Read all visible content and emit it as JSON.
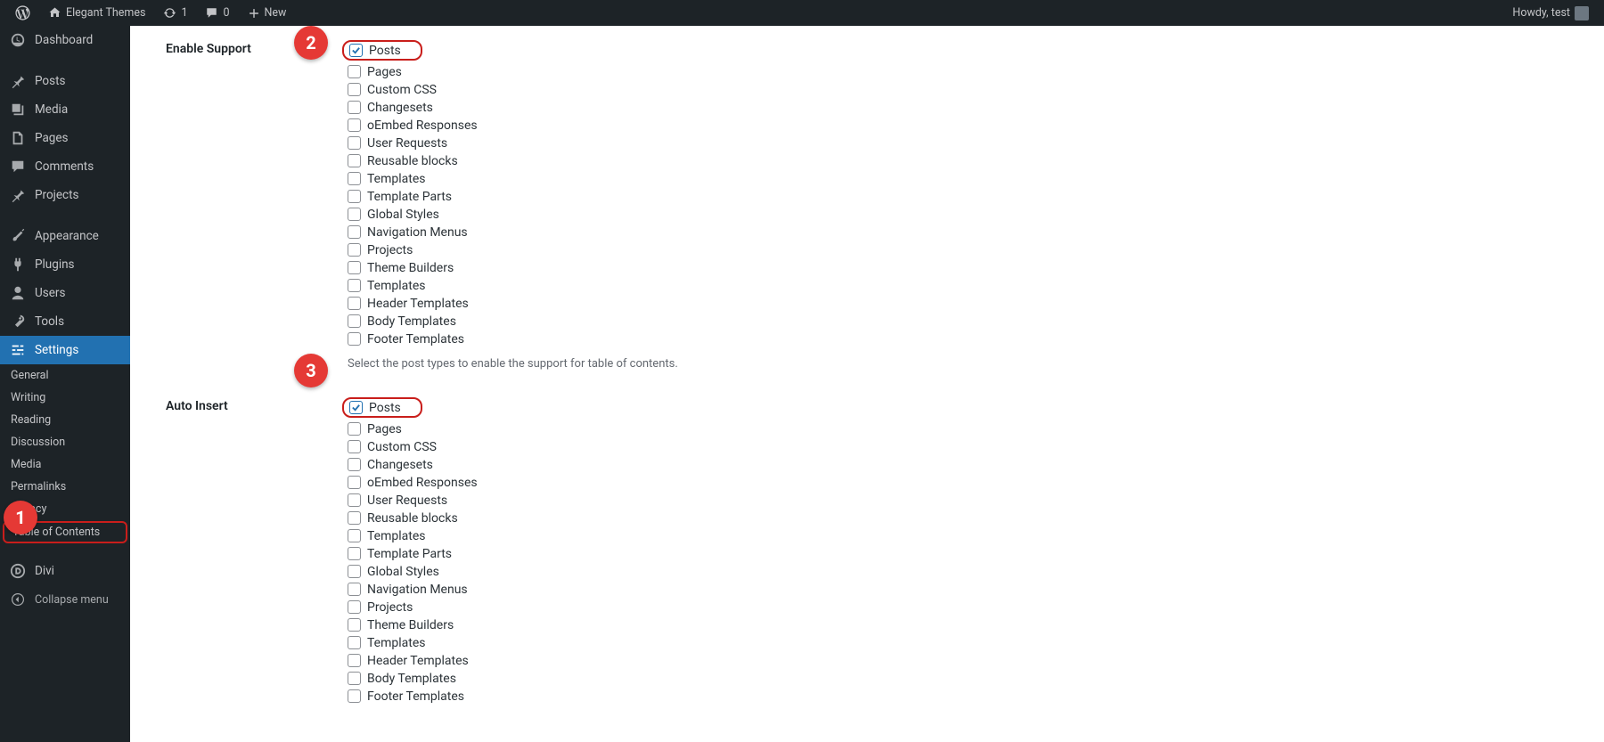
{
  "topbar": {
    "site": "Elegant Themes",
    "updates": "1",
    "comments": "0",
    "new": "New",
    "howdy": "Howdy, test"
  },
  "sidebar": {
    "dashboard": "Dashboard",
    "posts": "Posts",
    "media": "Media",
    "pages": "Pages",
    "comments": "Comments",
    "projects": "Projects",
    "appearance": "Appearance",
    "plugins": "Plugins",
    "users": "Users",
    "tools": "Tools",
    "settings": "Settings",
    "sub": {
      "general": "General",
      "writing": "Writing",
      "reading": "Reading",
      "discussion": "Discussion",
      "media": "Media",
      "permalinks": "Permalinks",
      "privacy": "Privacy",
      "toc": "Table of Contents"
    },
    "divi": "Divi",
    "collapse": "Collapse menu"
  },
  "content": {
    "enable_support_label": "Enable Support",
    "auto_insert_label": "Auto Insert",
    "enable_support_desc": "Select the post types to enable the support for table of contents.",
    "types": {
      "posts": "Posts",
      "pages": "Pages",
      "custom_css": "Custom CSS",
      "changesets": "Changesets",
      "oembed": "oEmbed Responses",
      "user_requests": "User Requests",
      "reusable": "Reusable blocks",
      "templates": "Templates",
      "template_parts": "Template Parts",
      "global_styles": "Global Styles",
      "nav_menus": "Navigation Menus",
      "projects": "Projects",
      "theme_builders": "Theme Builders",
      "templates2": "Templates",
      "header_tmpl": "Header Templates",
      "body_tmpl": "Body Templates",
      "footer_tmpl": "Footer Templates"
    }
  },
  "circles": {
    "c1": "1",
    "c2": "2",
    "c3": "3"
  }
}
